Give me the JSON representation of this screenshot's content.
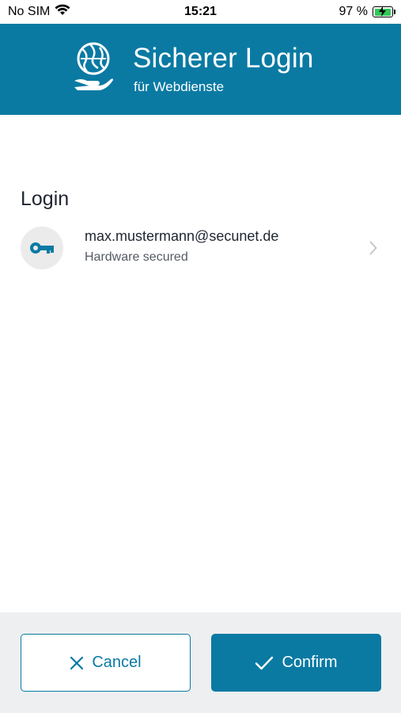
{
  "status_bar": {
    "carrier": "No SIM",
    "time": "15:21",
    "battery_percent": "97 %",
    "battery_level": 0.97,
    "icons": [
      "wifi-icon",
      "battery-charging-icon"
    ]
  },
  "header": {
    "title": "Sicherer Login",
    "subtitle": "für Webdienste",
    "logo_icon": "globe-hand-logo-icon",
    "background_color": "#0a7aa3"
  },
  "main": {
    "section_title": "Login",
    "items": [
      {
        "icon": "key-icon",
        "email": "max.mustermann@secunet.de",
        "subtitle": "Hardware secured"
      }
    ]
  },
  "footer": {
    "cancel_label": "Cancel",
    "confirm_label": "Confirm",
    "accent_color": "#0a7aa3"
  }
}
